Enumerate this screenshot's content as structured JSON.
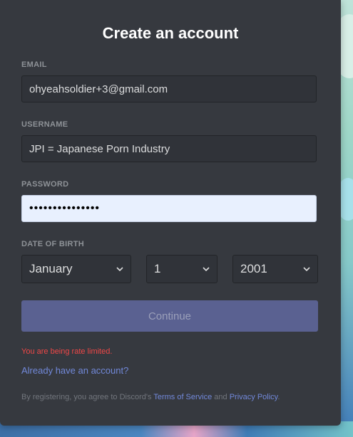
{
  "title": "Create an account",
  "email": {
    "label": "EMAIL",
    "value": "ohyeahsoldier+3@gmail.com"
  },
  "username": {
    "label": "USERNAME",
    "value": "JPI = Japanese Porn Industry"
  },
  "password": {
    "label": "PASSWORD",
    "masked_value": "•••••••••••••••"
  },
  "dob": {
    "label": "DATE OF BIRTH",
    "month": "January",
    "day": "1",
    "year": "2001"
  },
  "continue_label": "Continue",
  "error_text": "You are being rate limited.",
  "login_link": "Already have an account?",
  "tos": {
    "prefix": "By registering, you agree to Discord's ",
    "terms_link": "Terms of Service",
    "conjunction": " and ",
    "privacy_link": "Privacy Policy",
    "suffix": "."
  },
  "colors": {
    "card_bg": "#36393f",
    "input_bg": "#303339",
    "accent": "#7289da",
    "button_disabled": "#5a6191",
    "error": "#f04747",
    "label": "#8e9297"
  },
  "icons": {
    "select_chevron": "chevron-down-icon"
  }
}
